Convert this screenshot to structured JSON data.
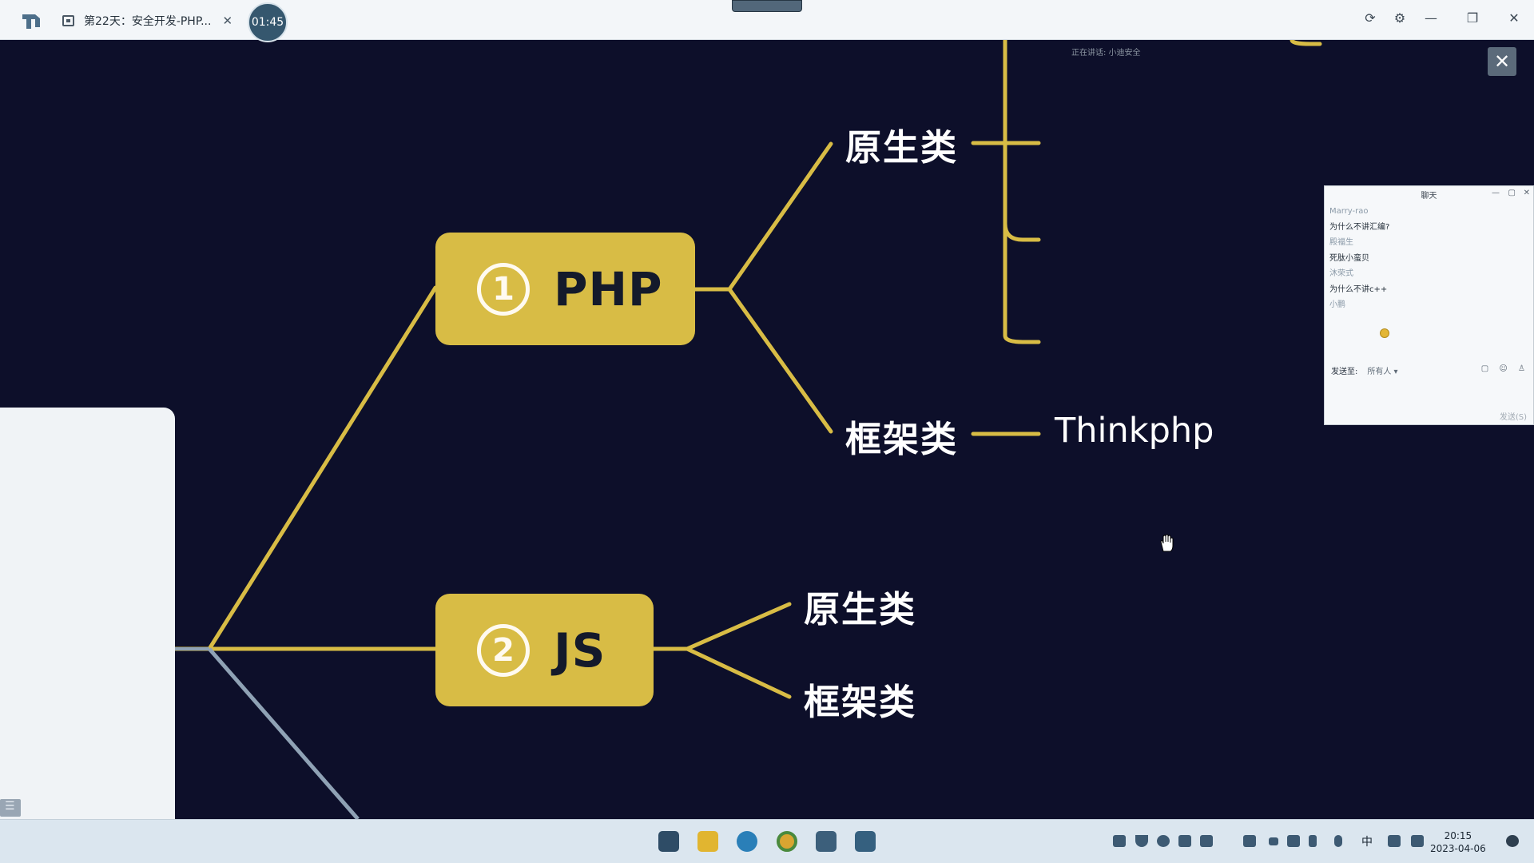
{
  "tab": {
    "title": "第22天：安全开发-PHP...",
    "close": "✕"
  },
  "timer": "01:45",
  "window_controls": {
    "refresh": "⟳",
    "settings": "⚙",
    "minimize": "—",
    "restore": "❐",
    "close": "✕"
  },
  "lecture": {
    "close": "✕",
    "speaking": "正在讲话: 小迪安全"
  },
  "mindmap": {
    "node1": {
      "num": "1",
      "label": "PHP"
    },
    "node2": {
      "num": "2",
      "label": "JS"
    },
    "php_branch1": "原生类",
    "php_branch2": "框架类",
    "php_leaf2": "Thinkphp",
    "js_branch1": "原生类",
    "js_branch2": "框架类"
  },
  "chat": {
    "title": "聊天",
    "messages": [
      {
        "sender": "Marry-rao",
        "content": "为什么不讲汇编?"
      },
      {
        "sender": "殿福生",
        "content": "死肽小蛮贝"
      },
      {
        "sender": "沐荣式",
        "content": "为什么不讲c++"
      },
      {
        "sender": "小鹏",
        "content": ""
      }
    ],
    "send_to_label": "发送至:",
    "send_to_value": "所有人 ▾",
    "send_button": "发送(S)"
  },
  "taskbar": {
    "ime": "中",
    "time": "20:15",
    "date": "2023-04-06"
  },
  "colors": {
    "background": "#0d0f2a",
    "node": "#d8bc45",
    "line": "#d8bc45",
    "grey_line": "#8fa2b5"
  }
}
